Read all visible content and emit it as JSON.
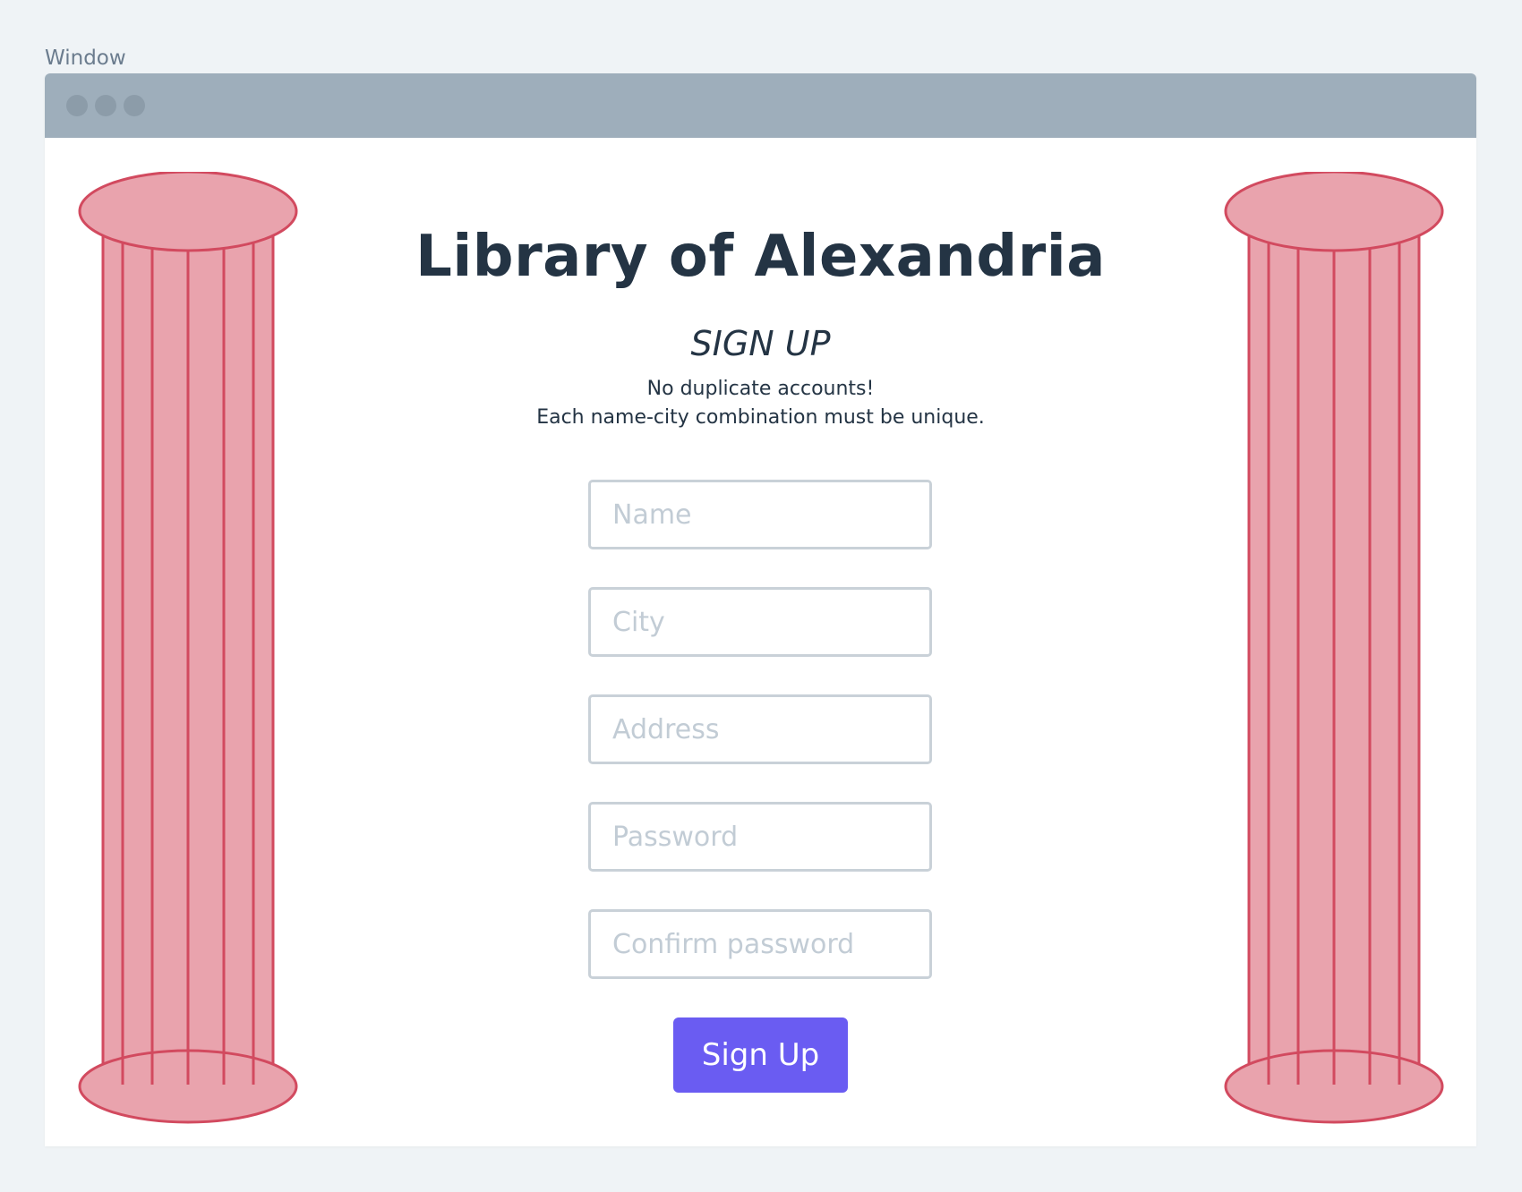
{
  "window": {
    "label": "Window"
  },
  "colors": {
    "page_background": "#eff3f6",
    "titlebar": "#9eaebb",
    "column_fill": "#e9a3ad",
    "column_stroke": "#d24a5f",
    "heading_text": "#243444",
    "input_border": "#c9d1d8",
    "placeholder_text": "#c2ccd5",
    "button_background": "#6a5cf2",
    "button_text": "#ffffff"
  },
  "decorations": {
    "left": "greek-column-icon",
    "right": "greek-column-icon"
  },
  "page": {
    "title": "Library of Alexandria",
    "subtitle": "SIGN UP",
    "note_line1": "No duplicate accounts!",
    "note_line2": "Each name-city combination must be unique."
  },
  "form": {
    "name_placeholder": "Name",
    "city_placeholder": "City",
    "address_placeholder": "Address",
    "password_placeholder": "Password",
    "confirm_password_placeholder": "Confirm password",
    "submit_label": "Sign Up"
  }
}
